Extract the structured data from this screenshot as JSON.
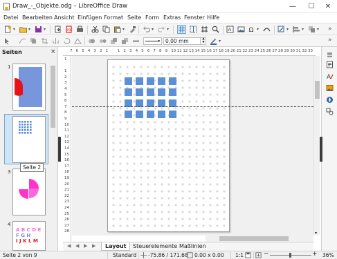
{
  "window": {
    "title": "Draw_-_Objekte.odg – LibreOffice Draw",
    "min_icon": "minimize-icon",
    "max_icon": "maximize-icon",
    "close_icon": "close-icon"
  },
  "menu": [
    "Datei",
    "Bearbeiten",
    "Ansicht",
    "Einfügen",
    "Format",
    "Seite",
    "Form",
    "Extras",
    "Fenster",
    "Hilfe"
  ],
  "toolbar2": {
    "line_width": "0,00 mm"
  },
  "slides_panel": {
    "title": "Seiten",
    "close": "×",
    "items": [
      {
        "number": "1"
      },
      {
        "number": "2"
      },
      {
        "number": "3"
      },
      {
        "number": "4",
        "text_lines": [
          "A B C D E",
          "F G H",
          "I J K L M"
        ]
      }
    ],
    "tooltip": "Seite 2"
  },
  "ruler": {
    "h_labels": [
      "7",
      "6",
      "5",
      "4",
      "3",
      "2",
      "1",
      "",
      "1",
      "2",
      "3",
      "4",
      "5",
      "6",
      "7",
      "8",
      "9",
      "10",
      "11",
      "12",
      "13",
      "14",
      "15",
      "16",
      "17",
      "18",
      "19",
      "20",
      "21",
      "22",
      "23",
      "24",
      "25",
      "26",
      "27",
      "28",
      "29",
      "30",
      "31",
      "32",
      "33"
    ],
    "v_labels": [
      "1",
      "",
      "1",
      "2",
      "3",
      "4",
      "5",
      "6",
      "7",
      "8",
      "9",
      "10",
      "11",
      "12",
      "13",
      "14",
      "15",
      "16",
      "17",
      "18",
      "19",
      "20",
      "21",
      "22",
      "23",
      "24",
      "25",
      "26",
      "27",
      "28"
    ]
  },
  "tabs": [
    "Layout",
    "Steuerelemente",
    "Maßlinien"
  ],
  "status": {
    "page": "Seite 2 von 9",
    "layout": "Standard",
    "position": "-75.86 / 171.68",
    "size": "0.00 x 0.00",
    "scale": "1:1",
    "zoom": "36%"
  },
  "colors": {
    "accent": "#4f81bd",
    "shape_blue": "#5b8fd6",
    "pink": "#ff33cc",
    "red": "#e8121b",
    "selection": "#cfe4f7"
  }
}
